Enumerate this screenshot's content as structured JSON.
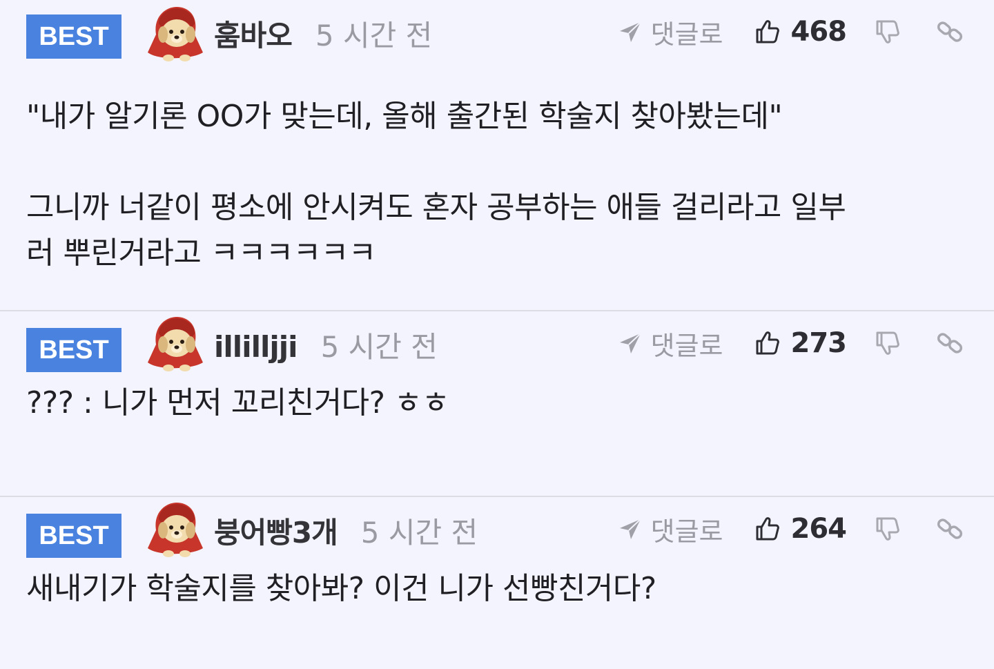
{
  "comments": [
    {
      "badge": "BEST",
      "username": "훔바오",
      "time": "5 시간 전",
      "reply_label": "댓글로",
      "likes": "468",
      "text": "\"내가 알기론 OO가 맞는데, 올해 출간된 학술지 찾아봤는데\"\n\n그니까 너같이 평소에 안시켜도 혼자 공부하는 애들 걸리라고 일부\n러 뿌린거라고 ㅋㅋㅋㅋㅋㅋ"
    },
    {
      "badge": "BEST",
      "username": "illilljji",
      "time": "5 시간 전",
      "reply_label": "댓글로",
      "likes": "273",
      "text": "??? : 니가 먼저 꼬리친거다? ㅎㅎ"
    },
    {
      "badge": "BEST",
      "username": "붕어빵3개",
      "time": "5 시간 전",
      "reply_label": "댓글로",
      "likes": "264",
      "text": "새내기가 학술지를 찾아봐? 이건 니가 선빵친거다?"
    }
  ],
  "icons": {
    "avatar": "puppy-red-hood-avatar",
    "reply": "send-arrow-icon",
    "like": "thumbs-up-icon",
    "dislike": "thumbs-down-icon",
    "link": "link-icon"
  },
  "colors": {
    "badge": "#4a82e0",
    "background": "#f3f4fd",
    "muted": "#9a9aa3"
  }
}
